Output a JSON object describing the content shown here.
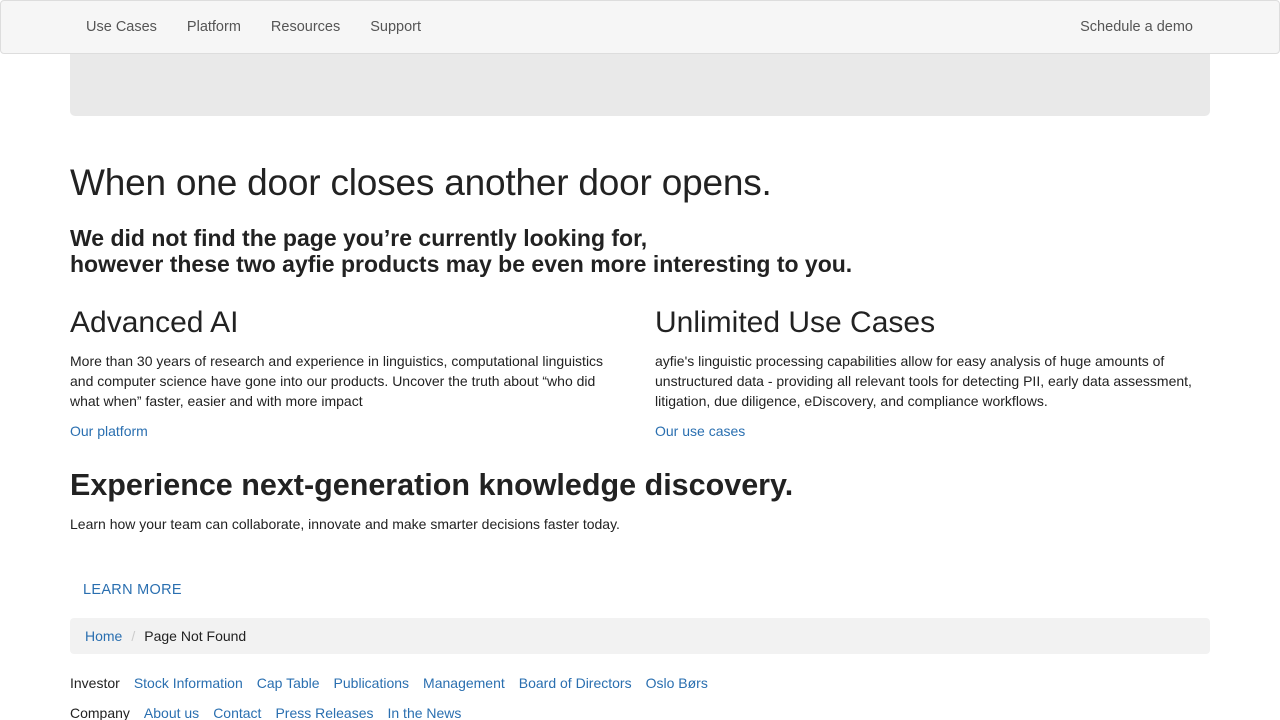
{
  "nav": {
    "items": [
      {
        "label": "Use Cases"
      },
      {
        "label": "Platform"
      },
      {
        "label": "Resources"
      },
      {
        "label": "Support"
      }
    ],
    "cta": "Schedule a demo"
  },
  "heading": "When one door closes another door opens.",
  "subheading": {
    "line1": "We did not find the page you’re currently looking for,",
    "line2": "however these two ayfie products may be even more interesting to you."
  },
  "columns": [
    {
      "title": "Advanced AI",
      "text": "More than 30 years of research and experience in linguistics, computational linguistics and computer science have gone into our products. Uncover the truth about “who did what when” faster, easier and with more impact",
      "link": "Our platform"
    },
    {
      "title": "Unlimited Use Cases",
      "text": "ayfie's linguistic processing capabilities allow for easy analysis of huge amounts of unstructured data - providing all relevant tools for detecting PII, early data assessment, litigation, due diligence, eDiscovery, and compliance workflows.",
      "link": "Our use cases"
    }
  ],
  "cta": {
    "title": "Experience next-generation knowledge discovery.",
    "text": "Learn how your team can collaborate, innovate and make smarter decisions faster today.",
    "button": "LEARN MORE"
  },
  "breadcrumb": {
    "home": "Home",
    "separator": "/",
    "current": "Page Not Found"
  },
  "footer": {
    "investor": {
      "label": "Investor",
      "links": [
        "Stock Information",
        "Cap Table",
        "Publications",
        "Management",
        "Board of Directors",
        "Oslo Børs"
      ]
    },
    "company": {
      "label": "Company",
      "links": [
        "About us",
        "Contact",
        "Press Releases",
        "In the News"
      ]
    }
  },
  "colors": {
    "link": "#2a6fb0",
    "text": "#222222",
    "navbar_bg": "#f6f6f6",
    "hero_bg": "#e9e9e9",
    "breadcrumb_bg": "#f2f2f2"
  }
}
